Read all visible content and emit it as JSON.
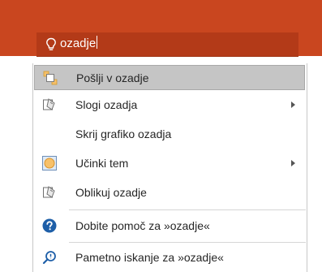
{
  "search": {
    "value": "ozadje"
  },
  "menu": {
    "items": [
      {
        "label": "Pošlji v ozadje",
        "icon": "send-to-back-icon",
        "has_submenu": false
      },
      {
        "label": "Slogi ozadja",
        "icon": "background-styles-icon",
        "has_submenu": true
      },
      {
        "label": "Skrij grafiko ozadja",
        "icon": "",
        "has_submenu": false
      },
      {
        "label": "Učinki tem",
        "icon": "theme-effects-icon",
        "has_submenu": true
      },
      {
        "label": "Oblikuj ozadje",
        "icon": "format-background-icon",
        "has_submenu": false
      },
      {
        "label": "Dobite pomoč za »ozadje«",
        "icon": "help-icon",
        "has_submenu": false
      },
      {
        "label": "Pametno iskanje za »ozadje«",
        "icon": "smart-lookup-icon",
        "has_submenu": false
      }
    ]
  },
  "colors": {
    "ribbon": "#c9461f",
    "search_box": "#b33a18",
    "highlight": "#c5c5c5",
    "help_blue": "#1e5fa8"
  }
}
